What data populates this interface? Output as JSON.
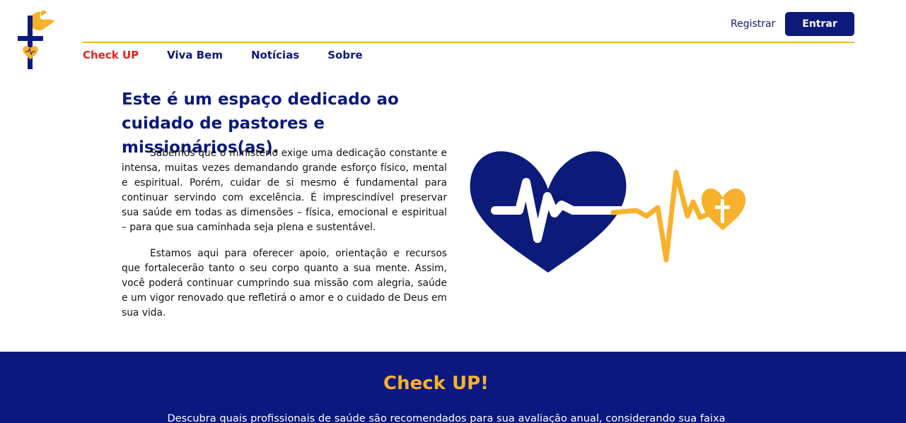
{
  "header": {
    "logo_icon": "cross-dove-heart-logo-icon",
    "register_label": "Registrar",
    "login_label": "Entrar"
  },
  "nav": {
    "items": [
      {
        "label": "Check UP",
        "active": true
      },
      {
        "label": "Viva Bem",
        "active": false
      },
      {
        "label": "Notícias",
        "active": false
      },
      {
        "label": "Sobre",
        "active": false
      }
    ]
  },
  "intro": {
    "title": "Este é um espaço dedicado ao cuidado de pastores e missionários(as).",
    "paragraphs": [
      "Sabemos que o ministério exige uma dedicação constante e intensa, muitas vezes demandando grande esforço físico, mental e espiritual. Porém, cuidar de si mesmo é fundamental para continuar servindo com excelência. É imprescindível preservar sua saúde em todas as dimensões – física, emocional e espiritual – para que sua caminhada seja plena e sustentável.",
      "Estamos aqui para oferecer apoio, orientação e recursos que fortalecerão tanto o seu corpo quanto a sua mente. Assim, você poderá continuar cumprindo sua missão com alegria, saúde e um vigor renovado que refletirá o amor e o cuidado de Deus em sua vida."
    ],
    "illustration_icon": "heartbeat-heart-cross-icon"
  },
  "checkup": {
    "title": "Check UP!",
    "description": "Descubra quais profissionais de saúde são recomendados para sua avaliação anual, considerando sua faixa"
  },
  "colors": {
    "navy": "#0c1a7a",
    "section_bg": "#0a1880",
    "accent_yellow": "#f7b12b",
    "active_red": "#e4241c"
  }
}
